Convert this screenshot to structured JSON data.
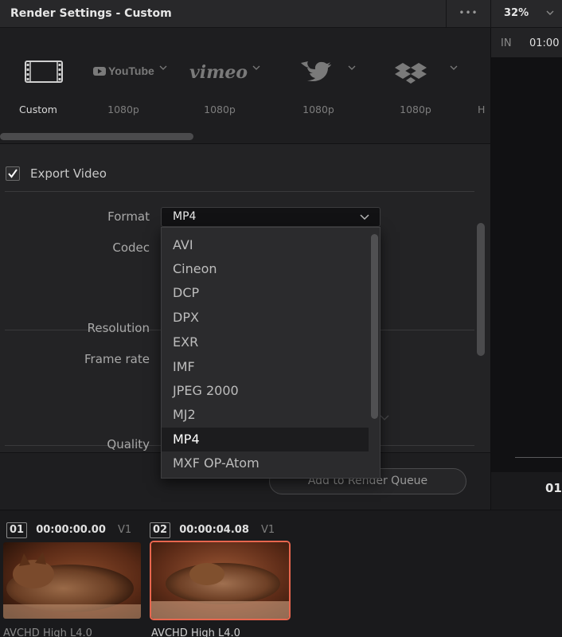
{
  "window": {
    "title": "Render Settings - Custom",
    "more_label": "•••"
  },
  "viewer": {
    "zoom": "32%",
    "in_label": "IN",
    "in_timecode": "01:00",
    "timecode": "01"
  },
  "presets": [
    {
      "name": "Custom",
      "label": "Custom",
      "icon": "film-strip-icon",
      "active": true
    },
    {
      "name": "YouTube",
      "label": "1080p",
      "icon": "youtube-logo-icon"
    },
    {
      "name": "Vimeo",
      "label": "1080p",
      "icon": "vimeo-logo-icon"
    },
    {
      "name": "Twitter",
      "label": "1080p",
      "icon": "twitter-bird-icon"
    },
    {
      "name": "Dropbox",
      "label": "1080p",
      "icon": "dropbox-logo-icon"
    },
    {
      "name": "more",
      "label": "H"
    }
  ],
  "preset_logos": {
    "youtube": "YouTube",
    "vimeo": "vimeo"
  },
  "export_video": {
    "label": "Export Video",
    "checked": true
  },
  "fields": {
    "format": "Format",
    "codec": "Codec",
    "resolution": "Resolution",
    "frame_rate": "Frame rate",
    "quality": "Quality"
  },
  "format": {
    "value": "MP4",
    "options": [
      "AVI",
      "Cineon",
      "DCP",
      "DPX",
      "EXR",
      "IMF",
      "JPEG 2000",
      "MJ2",
      "MP4",
      "MXF OP-Atom"
    ],
    "selected": "MP4"
  },
  "footer": {
    "add_to_queue": "Add to Render Queue"
  },
  "clips": [
    {
      "number": "01",
      "timecode": "00:00:00.00",
      "track": "V1",
      "codec": "AVCHD High L4.0",
      "selected": false
    },
    {
      "number": "02",
      "timecode": "00:00:04.08",
      "track": "V1",
      "codec": "AVCHD High L4.0",
      "selected": true
    }
  ],
  "colors": {
    "accent_selected": "#e8664e",
    "panel_bg": "#232325",
    "dropdown_bg": "#2b2b2d"
  }
}
